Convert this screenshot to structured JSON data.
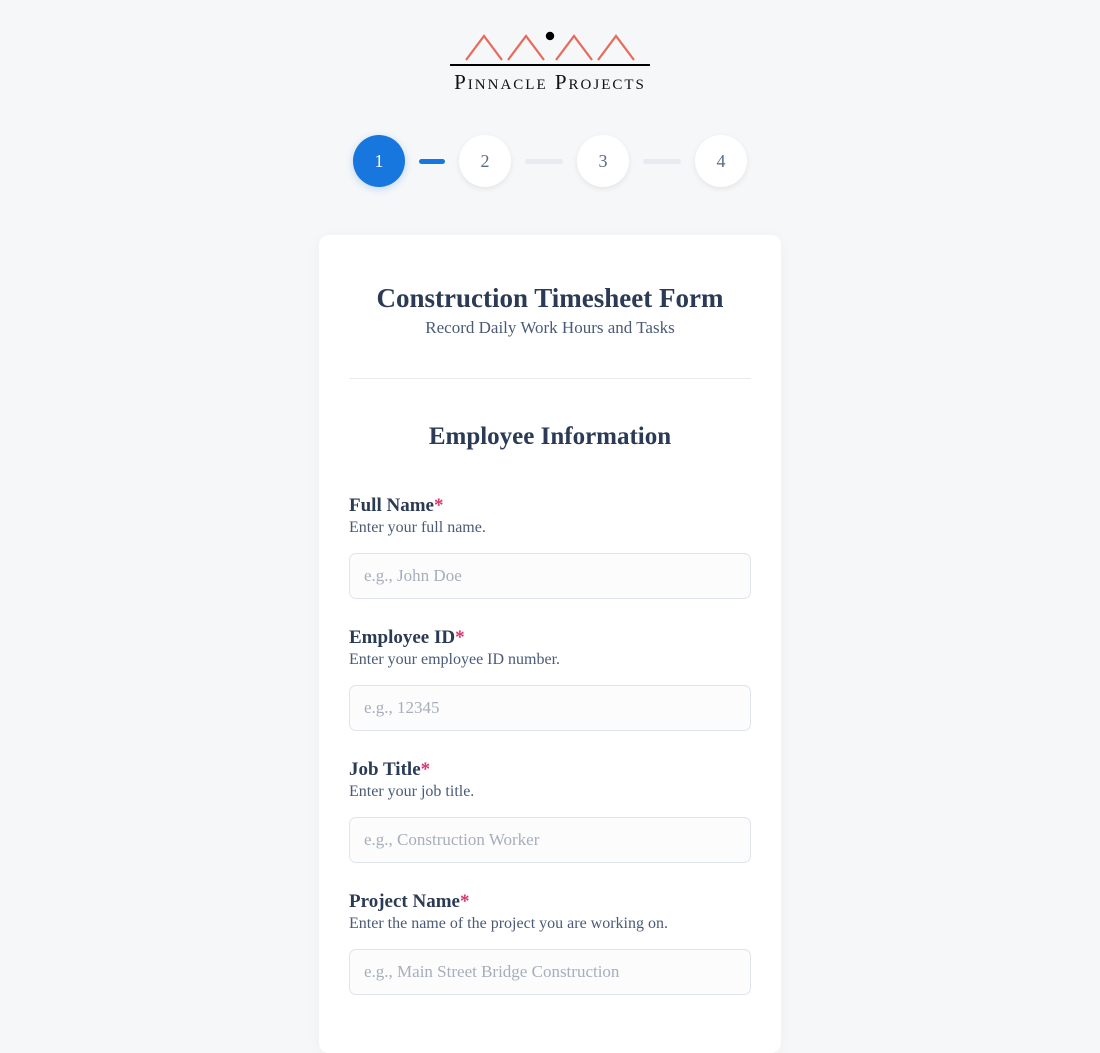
{
  "brand": {
    "name": "Pinnacle Projects"
  },
  "progress": {
    "steps": [
      "1",
      "2",
      "3",
      "4"
    ],
    "current": 1
  },
  "form": {
    "title": "Construction Timesheet Form",
    "subtitle": "Record Daily Work Hours and Tasks",
    "section_title": "Employee Information",
    "required_mark": "*",
    "fields": [
      {
        "label": "Full Name",
        "required": true,
        "hint": "Enter your full name.",
        "placeholder": "e.g., John Doe",
        "value": ""
      },
      {
        "label": "Employee ID",
        "required": true,
        "hint": "Enter your employee ID number.",
        "placeholder": "e.g., 12345",
        "value": ""
      },
      {
        "label": "Job Title",
        "required": true,
        "hint": "Enter your job title.",
        "placeholder": "e.g., Construction Worker",
        "value": ""
      },
      {
        "label": "Project Name",
        "required": true,
        "hint": "Enter the name of the project you are working on.",
        "placeholder": "e.g., Main Street Bridge Construction",
        "value": ""
      }
    ]
  }
}
